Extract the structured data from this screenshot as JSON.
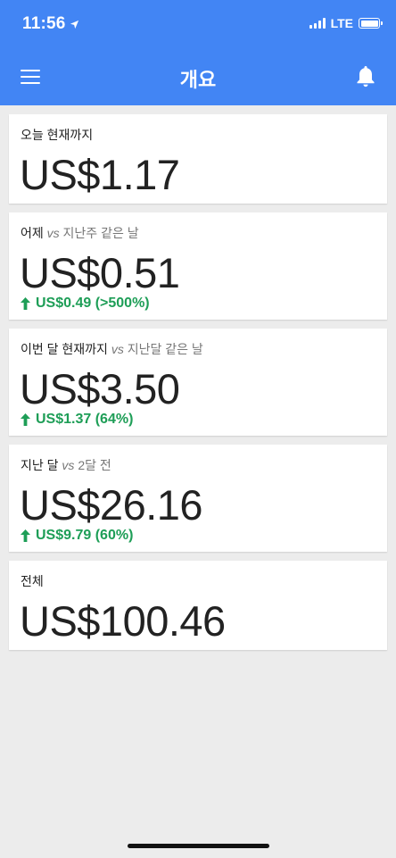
{
  "status_bar": {
    "time": "11:56",
    "network": "LTE"
  },
  "app_bar": {
    "title": "개요",
    "left_icon": "hamburger-menu-icon",
    "right_icon": "bell-icon"
  },
  "colors": {
    "app_bar": "#4285f4",
    "background": "#ececec",
    "positive": "#1e9e57"
  },
  "cards": [
    {
      "label": "오늘 현재까지",
      "value": "US$1.17"
    },
    {
      "label": "어제",
      "vs": "vs",
      "compare": "지난주 같은 날",
      "value": "US$0.51",
      "change": "US$0.49 (>500%)",
      "change_direction": "up"
    },
    {
      "label": "이번 달 현재까지",
      "vs": "vs",
      "compare": "지난달 같은 날",
      "value": "US$3.50",
      "change": "US$1.37 (64%)",
      "change_direction": "up"
    },
    {
      "label": "지난 달",
      "vs": "vs",
      "compare": "2달 전",
      "value": "US$26.16",
      "change": "US$9.79 (60%)",
      "change_direction": "up"
    },
    {
      "label": "전체",
      "value": "US$100.46"
    }
  ]
}
